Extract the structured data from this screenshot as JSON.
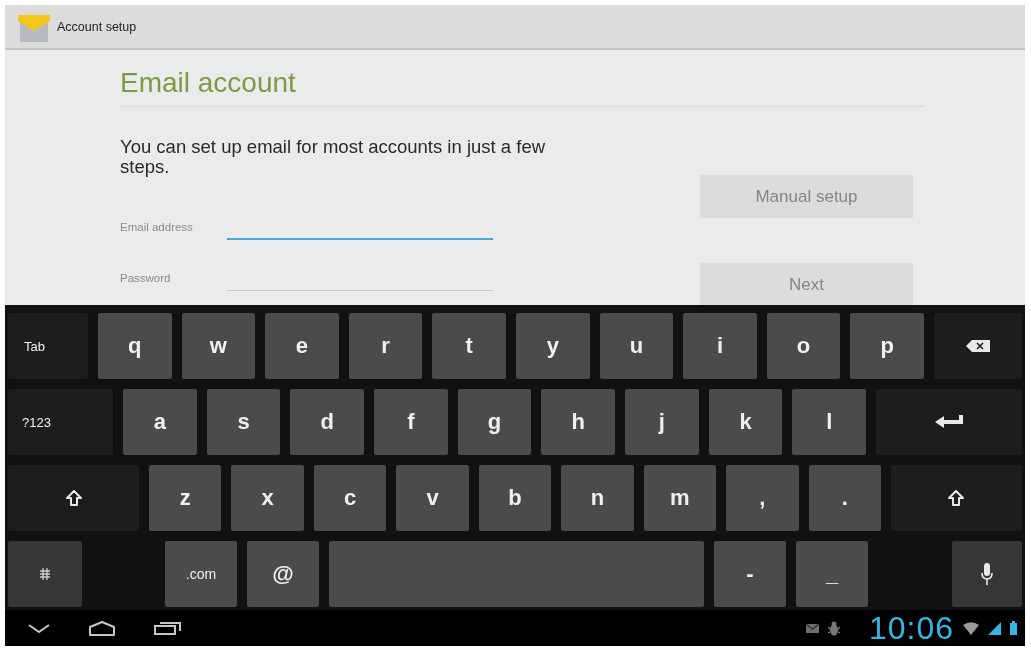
{
  "action_bar": {
    "title": "Account setup"
  },
  "form": {
    "heading": "Email account",
    "description": "You can set up email for most accounts in just a few steps.",
    "fields": [
      {
        "label": "Email address",
        "focused": true
      },
      {
        "label": "Password",
        "focused": false
      }
    ],
    "buttons": [
      {
        "label": "Manual setup",
        "disabled": true
      },
      {
        "label": "Next",
        "disabled": true
      }
    ]
  },
  "keyboard": {
    "rows": [
      [
        {
          "kind": "mod",
          "label": "Tab"
        },
        {
          "kind": "char",
          "label": "q"
        },
        {
          "kind": "char",
          "label": "w"
        },
        {
          "kind": "char",
          "label": "e"
        },
        {
          "kind": "char",
          "label": "r"
        },
        {
          "kind": "char",
          "label": "t"
        },
        {
          "kind": "char",
          "label": "y"
        },
        {
          "kind": "char",
          "label": "u"
        },
        {
          "kind": "char",
          "label": "i"
        },
        {
          "kind": "char",
          "label": "o"
        },
        {
          "kind": "char",
          "label": "p"
        },
        {
          "kind": "backspace"
        }
      ],
      [
        {
          "kind": "mod",
          "label": "?123"
        },
        {
          "kind": "char",
          "label": "a"
        },
        {
          "kind": "char",
          "label": "s"
        },
        {
          "kind": "char",
          "label": "d"
        },
        {
          "kind": "char",
          "label": "f"
        },
        {
          "kind": "char",
          "label": "g"
        },
        {
          "kind": "char",
          "label": "h"
        },
        {
          "kind": "char",
          "label": "j"
        },
        {
          "kind": "char",
          "label": "k"
        },
        {
          "kind": "char",
          "label": "l"
        },
        {
          "kind": "enter"
        }
      ],
      [
        {
          "kind": "shift"
        },
        {
          "kind": "char",
          "label": "z"
        },
        {
          "kind": "char",
          "label": "x"
        },
        {
          "kind": "char",
          "label": "c"
        },
        {
          "kind": "char",
          "label": "v"
        },
        {
          "kind": "char",
          "label": "b"
        },
        {
          "kind": "char",
          "label": "n"
        },
        {
          "kind": "char",
          "label": "m"
        },
        {
          "kind": "char",
          "label": ","
        },
        {
          "kind": "char",
          "label": "."
        },
        {
          "kind": "shift"
        }
      ],
      [
        {
          "kind": "settings"
        },
        {
          "kind": "word",
          "label": ".com"
        },
        {
          "kind": "char",
          "label": "@"
        },
        {
          "kind": "space"
        },
        {
          "kind": "char",
          "label": "-"
        },
        {
          "kind": "char",
          "label": "_"
        },
        {
          "kind": "mic"
        }
      ]
    ]
  },
  "status_bar": {
    "time": "10:06"
  }
}
